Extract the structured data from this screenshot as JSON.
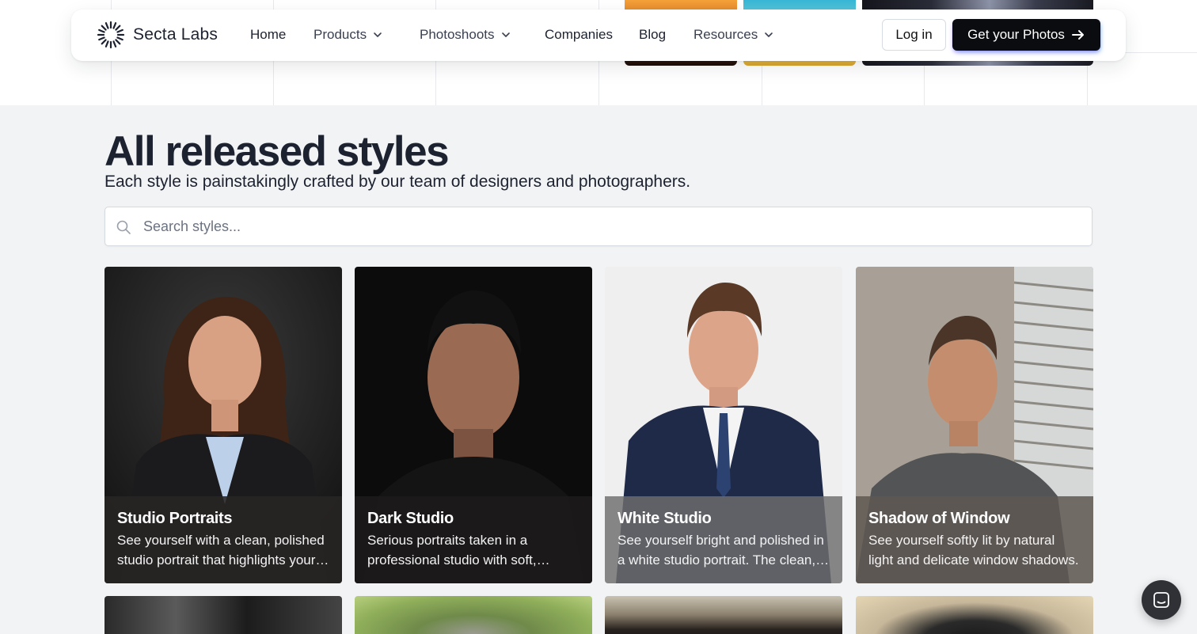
{
  "brand": {
    "name": "Secta Labs"
  },
  "nav": {
    "items": [
      {
        "label": "Home",
        "has_menu": false
      },
      {
        "label": "Products",
        "has_menu": true
      },
      {
        "label": "Photoshoots",
        "has_menu": true
      },
      {
        "label": "Companies",
        "has_menu": false
      },
      {
        "label": "Blog",
        "has_menu": false
      },
      {
        "label": "Resources",
        "has_menu": true
      }
    ],
    "login_label": "Log in",
    "cta_label": "Get your Photos"
  },
  "section": {
    "title": "All released styles",
    "subtitle": "Each style is painstakingly crafted by our team of designers and photographers."
  },
  "search": {
    "placeholder": "Search styles...",
    "value": ""
  },
  "styles": [
    {
      "title": "Studio Portraits",
      "description": "See yourself with a clean, polished studio portrait that highlights your best features."
    },
    {
      "title": "Dark Studio",
      "description": "Serious portraits taken in a professional studio with soft, dramatic lighting."
    },
    {
      "title": "White Studio",
      "description": "See yourself bright and polished in a white studio portrait. The clean, crisp backdrop."
    },
    {
      "title": "Shadow of Window",
      "description": "See yourself softly lit by natural light and delicate window shadows."
    }
  ],
  "icons": {
    "logo": "sunburst-logo-icon",
    "dropdown": "chevron-down-icon",
    "cta": "arrow-right-icon",
    "search": "search-icon",
    "chat": "chat-icon"
  },
  "colors": {
    "text": "#1d2230",
    "cta_background": "#0b0c10",
    "page_background": "#f1f3f5"
  }
}
